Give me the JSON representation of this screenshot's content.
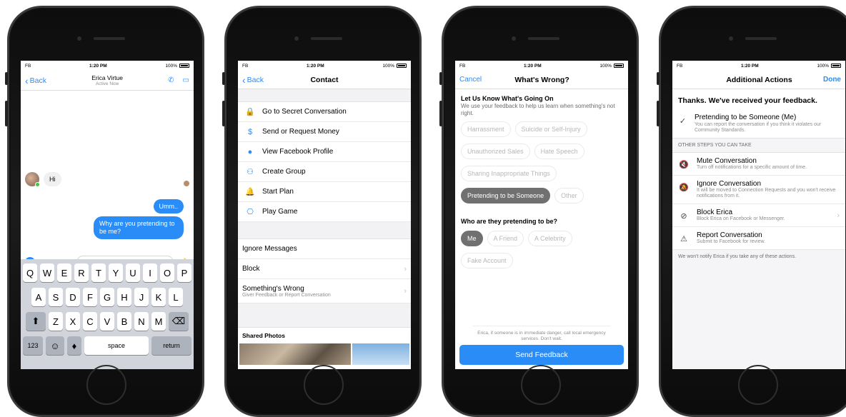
{
  "status": {
    "carrier": "FB",
    "time": "1:20 PM",
    "battery": "100%"
  },
  "phone1": {
    "back": "Back",
    "contact_name": "Erica Virtue",
    "contact_status": "Active Now",
    "msg_in": "Hi",
    "msg_out_1": "Umm..",
    "msg_out_2": "Why are you pretending to be me?",
    "input_placeholder": "Aa",
    "keys_row1": [
      "Q",
      "W",
      "E",
      "R",
      "T",
      "Y",
      "U",
      "I",
      "O",
      "P"
    ],
    "keys_row2": [
      "A",
      "S",
      "D",
      "F",
      "G",
      "H",
      "J",
      "K",
      "L"
    ],
    "keys_row3": [
      "Z",
      "X",
      "C",
      "V",
      "B",
      "N",
      "M"
    ],
    "key_numbers": "123",
    "key_space": "space",
    "key_return": "return"
  },
  "phone2": {
    "back": "Back",
    "title": "Contact",
    "menu": [
      {
        "label": "Go to Secret Conversation",
        "icon": "lock-icon"
      },
      {
        "label": "Send or Request Money",
        "icon": "dollar-icon"
      },
      {
        "label": "View Facebook Profile",
        "icon": "profile-icon"
      },
      {
        "label": "Create Group",
        "icon": "group-add-icon"
      },
      {
        "label": "Start Plan",
        "icon": "bell-icon"
      },
      {
        "label": "Play Game",
        "icon": "gamepad-icon"
      }
    ],
    "ignore": "Ignore Messages",
    "block": "Block",
    "wrong_title": "Something's Wrong",
    "wrong_sub": "Giver Feedback or Report Conversation",
    "shared_photos": "Shared Photos"
  },
  "phone3": {
    "cancel": "Cancel",
    "title": "What's Wrong?",
    "heading": "Let Us Know What's Going On",
    "desc": "We use your feedback to help us learn when something's not right.",
    "chips": [
      "Harrassment",
      "Suicide or Self-Injury",
      "Unauthorized Sales",
      "Hate Speech",
      "Sharing Inappropriate Things",
      "Pretending to be Someone",
      "Other"
    ],
    "selected_chip": "Pretending to be Someone",
    "who_heading": "Who are they pretending to be?",
    "who_chips": [
      "Me",
      "A Friend",
      "A Celebrity",
      "Fake Account"
    ],
    "selected_who": "Me",
    "emergency": "Erica, if someone is in immediate danger, call local emergency services. Don't wait.",
    "send": "Send Feedback"
  },
  "phone4": {
    "title": "Additional Actions",
    "done": "Done",
    "thanks": "Thanks. We've received your feedback.",
    "report_title": "Pretending to be Someone (Me)",
    "report_sub": "You can report the conversation if you think it violates our Community Standards.",
    "other_steps": "OTHER STEPS YOU CAN TAKE",
    "actions": [
      {
        "title": "Mute Conversation",
        "sub": "Turn off notifications for a specific amount of time.",
        "icon": "mute-icon"
      },
      {
        "title": "Ignore Conversation",
        "sub": "It will be moved to Connection Requests and you won't receive notifications from it.",
        "icon": "bell-off-icon"
      },
      {
        "title": "Block Erica",
        "sub": "Block Erica on Facebook or Messenger.",
        "icon": "block-icon"
      },
      {
        "title": "Report Conversation",
        "sub": "Submit to Facebook for review.",
        "icon": "warning-icon"
      }
    ],
    "footer": "We won't notify Erica if you take any of these actions."
  }
}
